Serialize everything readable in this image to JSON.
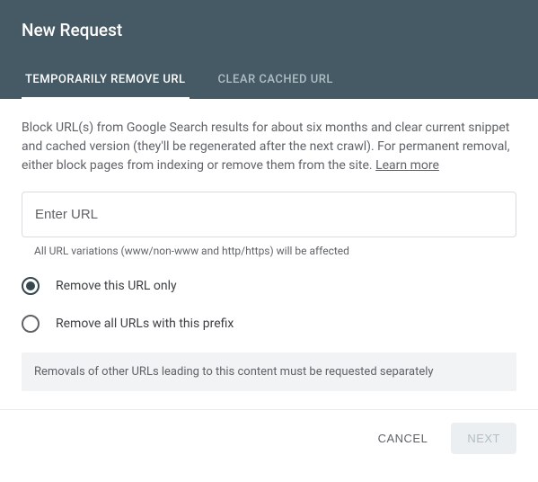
{
  "header": {
    "title": "New Request",
    "tabs": [
      {
        "label": "TEMPORARILY REMOVE URL",
        "active": true
      },
      {
        "label": "CLEAR CACHED URL",
        "active": false
      }
    ]
  },
  "body": {
    "description": "Block URL(s) from Google Search results for about six months and clear current snippet and cached version (they'll be regenerated after the next crawl). For permanent removal, either block pages from indexing or remove them from the site. ",
    "learn_more": "Learn more",
    "input_placeholder": "Enter URL",
    "helper_text": "All URL variations (www/non-www and http/https) will be affected",
    "radio_options": [
      {
        "label": "Remove this URL only",
        "selected": true
      },
      {
        "label": "Remove all URLs with this prefix",
        "selected": false
      }
    ],
    "note": "Removals of other URLs leading to this content must be requested separately"
  },
  "footer": {
    "cancel": "CANCEL",
    "next": "NEXT"
  }
}
